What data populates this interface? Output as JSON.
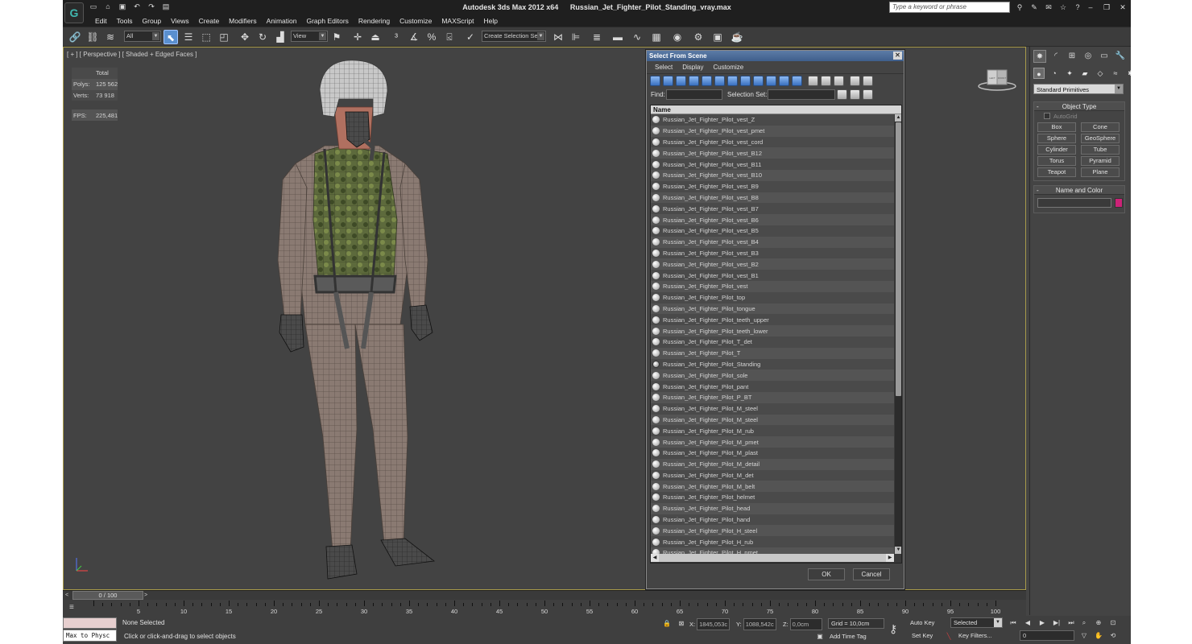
{
  "window": {
    "app_name": "Autodesk 3ds Max  2012 x64",
    "file_name": "Russian_Jet_Fighter_Pilot_Standing_vray.max",
    "search_placeholder": "Type a keyword or phrase",
    "logo_text": "G"
  },
  "menu": [
    "Edit",
    "Tools",
    "Group",
    "Views",
    "Create",
    "Modifiers",
    "Animation",
    "Graph Editors",
    "Rendering",
    "Customize",
    "MAXScript",
    "Help"
  ],
  "toolbar": {
    "filter_value": "All",
    "coord_value": "View",
    "selection_set_placeholder": "Create Selection Se"
  },
  "viewport": {
    "label": "[ + ] [ Perspective ] [ Shaded + Edged Faces ]",
    "stats_header": "Total",
    "stats": [
      {
        "key": "Polys:",
        "value": "125 562"
      },
      {
        "key": "Verts:",
        "value": "73 918"
      },
      {
        "key": "FPS:",
        "value": "225,481"
      }
    ],
    "viewcube_left": "LEFT",
    "viewcube_front": "FRONT"
  },
  "dialog": {
    "title": "Select From Scene",
    "menu": [
      "Select",
      "Display",
      "Customize"
    ],
    "find_label": "Find:",
    "selection_set_label": "Selection Set:",
    "column_name": "Name",
    "items": [
      "Russian_Jet_Fighter_Pilot_vest_Z",
      "Russian_Jet_Fighter_Pilot_vest_pmet",
      "Russian_Jet_Fighter_Pilot_vest_cord",
      "Russian_Jet_Fighter_Pilot_vest_B12",
      "Russian_Jet_Fighter_Pilot_vest_B11",
      "Russian_Jet_Fighter_Pilot_vest_B10",
      "Russian_Jet_Fighter_Pilot_vest_B9",
      "Russian_Jet_Fighter_Pilot_vest_B8",
      "Russian_Jet_Fighter_Pilot_vest_B7",
      "Russian_Jet_Fighter_Pilot_vest_B6",
      "Russian_Jet_Fighter_Pilot_vest_B5",
      "Russian_Jet_Fighter_Pilot_vest_B4",
      "Russian_Jet_Fighter_Pilot_vest_B3",
      "Russian_Jet_Fighter_Pilot_vest_B2",
      "Russian_Jet_Fighter_Pilot_vest_B1",
      "Russian_Jet_Fighter_Pilot_vest",
      "Russian_Jet_Fighter_Pilot_top",
      "Russian_Jet_Fighter_Pilot_tongue",
      "Russian_Jet_Fighter_Pilot_teeth_upper",
      "Russian_Jet_Fighter_Pilot_teeth_lower",
      "Russian_Jet_Fighter_Pilot_T_det",
      "Russian_Jet_Fighter_Pilot_T",
      "Russian_Jet_Fighter_Pilot_Standing",
      "Russian_Jet_Fighter_Pilot_sole",
      "Russian_Jet_Fighter_Pilot_pant",
      "Russian_Jet_Fighter_Pilot_P_BT",
      "Russian_Jet_Fighter_Pilot_M_steel",
      "Russian_Jet_Fighter_Pilot_M_steel",
      "Russian_Jet_Fighter_Pilot_M_rub",
      "Russian_Jet_Fighter_Pilot_M_pmet",
      "Russian_Jet_Fighter_Pilot_M_plast",
      "Russian_Jet_Fighter_Pilot_M_detail",
      "Russian_Jet_Fighter_Pilot_M_det",
      "Russian_Jet_Fighter_Pilot_M_belt",
      "Russian_Jet_Fighter_Pilot_helmet",
      "Russian_Jet_Fighter_Pilot_head",
      "Russian_Jet_Fighter_Pilot_hand",
      "Russian_Jet_Fighter_Pilot_H_steel",
      "Russian_Jet_Fighter_Pilot_H_rub",
      "Russian_Jet_Fighter_Pilot_H_pmet"
    ],
    "group_item": "Russian_Jet_Fighter_Pilot_Standing",
    "ok_label": "OK",
    "cancel_label": "Cancel"
  },
  "command_panel": {
    "dropdown": "Standard Primitives",
    "object_type_title": "Object Type",
    "autogrid": "AutoGrid",
    "buttons": [
      "Box",
      "Cone",
      "Sphere",
      "GeoSphere",
      "Cylinder",
      "Tube",
      "Torus",
      "Pyramid",
      "Teapot",
      "Plane"
    ],
    "name_color_title": "Name and Color",
    "color": "#cc2277"
  },
  "timeline": {
    "slider_label": "0 / 100",
    "ticks": [
      "5",
      "10",
      "15",
      "20",
      "25",
      "30",
      "35",
      "40",
      "45",
      "50",
      "55",
      "60",
      "65",
      "70",
      "75",
      "80",
      "85",
      "90",
      "95",
      "100"
    ]
  },
  "status": {
    "maxscript_label": "Max to Physc",
    "selection": "None Selected",
    "prompt": "Click or click-and-drag to select objects",
    "x_label": "X:",
    "x_value": "1845,053c",
    "y_label": "Y:",
    "y_value": "1088,542c",
    "z_label": "Z:",
    "z_value": "0,0cm",
    "grid": "Grid = 10,0cm",
    "add_time_tag": "Add Time Tag",
    "auto_key": "Auto Key",
    "set_key": "Set Key",
    "selected_dropdown": "Selected",
    "key_filters": "Key Filters...",
    "frame_value": "0"
  }
}
